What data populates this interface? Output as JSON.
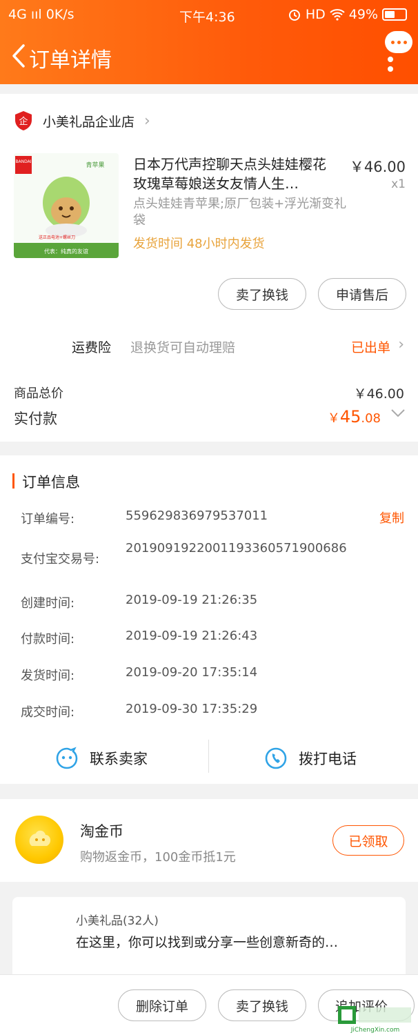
{
  "status_bar": {
    "left": "4G ııl 0K/s",
    "time": "下午4:36",
    "right": "HD",
    "battery": "49%"
  },
  "header": {
    "title": "订单详情"
  },
  "shop": {
    "name": "小美礼品企业店",
    "badge_text": "企"
  },
  "product": {
    "brand_text": "BANDAI",
    "image_label": "青苹果",
    "image_caption": "代表：纯真的友谊",
    "image_note": "送正品电池+螺丝刀",
    "title": "日本万代声控聊天点头娃娃樱花玫瑰草莓娘送女友情人生…",
    "price": "￥46.00",
    "qty": "x1",
    "spec": "点头娃娃青苹果;原厂包装+浮光渐变礼袋",
    "ship_time": "发货时间  48小时内发货"
  },
  "product_actions": {
    "sell": "卖了换钱",
    "after_sale": "申请售后"
  },
  "insurance": {
    "label": "运费险",
    "desc": "退换货可自动理赔",
    "status": "已出单"
  },
  "totals": {
    "total_label": "商品总价",
    "total_value": "￥46.00",
    "paid_label": "实付款",
    "paid_currency": "￥",
    "paid_int": "45",
    "paid_dec": ".08"
  },
  "order_info": {
    "title": "订单信息",
    "copy_label": "复制",
    "rows": [
      {
        "label": "订单编号:",
        "value": "559629836979537011"
      },
      {
        "label": "支付宝交易号:",
        "value": "2019091922001193360571900686"
      },
      {
        "label": "创建时间:",
        "value": "2019-09-19 21:26:35"
      },
      {
        "label": "付款时间:",
        "value": "2019-09-19 21:26:43"
      },
      {
        "label": "发货时间:",
        "value": "2019-09-20 17:35:14"
      },
      {
        "label": "成交时间:",
        "value": "2019-09-30 17:35:29"
      }
    ],
    "contact_seller": "联系卖家",
    "call_phone": "拨打电话"
  },
  "coins": {
    "title": "淘金币",
    "desc": "购物返金币，100金币抵1元",
    "button": "已领取"
  },
  "group": {
    "name": "小美礼品(32人)",
    "desc": "在这里，你可以找到或分享一些创意新奇的…"
  },
  "bottom_bar": {
    "delete": "删除订单",
    "sell": "卖了换钱",
    "review": "追加评价"
  },
  "watermark": {
    "text": "JiChengXin.com"
  },
  "colors": {
    "accent": "#ff5500",
    "header": "#ff6a10",
    "ship_time": "#e8a33b",
    "icon_blue": "#2fa3e6"
  }
}
